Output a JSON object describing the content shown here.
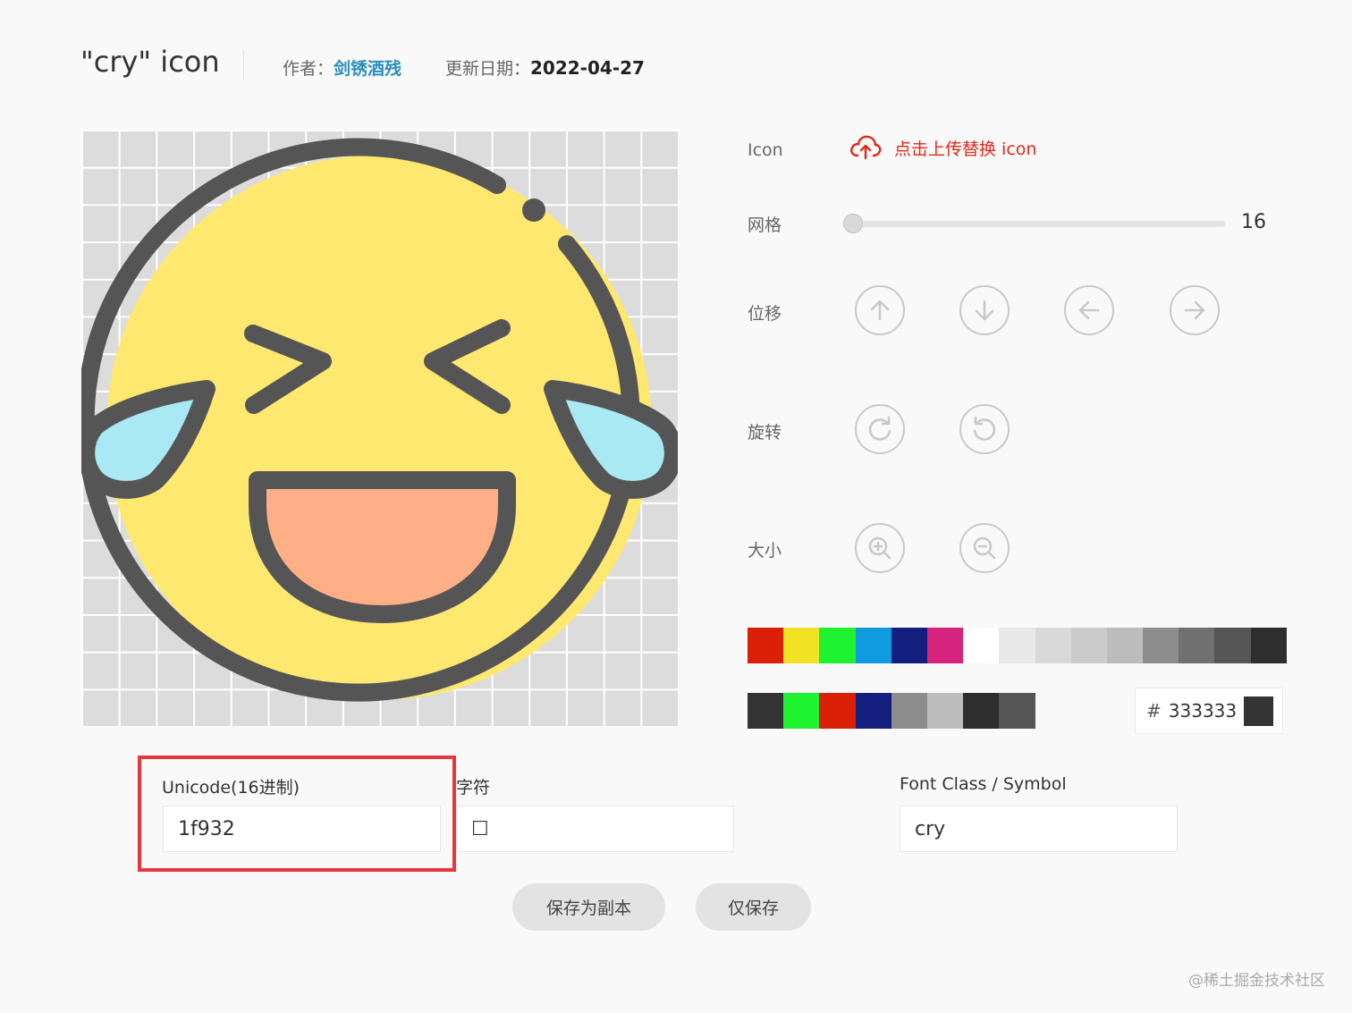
{
  "header": {
    "title": "\"cry\"  icon",
    "author_label": "作者：",
    "author_name": "剑锈酒残",
    "date_label": "更新日期：",
    "date_value": "2022-04-27"
  },
  "controls": {
    "icon_label": "Icon",
    "upload_text": "点击上传替换 icon",
    "grid_label": "网格",
    "grid_value": "16",
    "move_label": "位移",
    "rotate_label": "旋转",
    "size_label": "大小",
    "move_buttons": [
      "arrow-up-icon",
      "arrow-down-icon",
      "arrow-left-icon",
      "arrow-right-icon"
    ],
    "rotate_buttons": [
      "rotate-clockwise-icon",
      "rotate-counterclockwise-icon"
    ],
    "size_buttons": [
      "zoom-in-icon",
      "zoom-out-icon"
    ]
  },
  "palette": {
    "main": [
      "#db1e06",
      "#f1e225",
      "#1ff22e",
      "#119bdf",
      "#131f7f",
      "#d5237e",
      "#ffffff",
      "#e8e8e8",
      "#d9d9d9",
      "#cbcbcb",
      "#bcbcbc",
      "#8d8d8d",
      "#707070",
      "#565656",
      "#2e2e2e"
    ],
    "recent": [
      "#333333",
      "#1ff22e",
      "#db1e06",
      "#131f7f",
      "#8d8d8d",
      "#bcbcbc",
      "#2e2e2e",
      "#565656"
    ],
    "hex_symbol": "#",
    "hex_value": "333333",
    "current_color": "#333333"
  },
  "fields": {
    "unicode_label": "Unicode(16进制)",
    "unicode_value": "1f932",
    "char_label": "字符",
    "char_value": "☐",
    "fontclass_label": "Font Class / Symbol",
    "fontclass_value": "cry"
  },
  "actions": {
    "save_copy": "保存为副本",
    "save_only": "仅保存"
  },
  "watermark": "@稀土掘金技术社区",
  "emoji_colors": {
    "outline": "#555555",
    "face": "#ffe86f",
    "tear": "#a8e9f3",
    "mouth": "#ffaf86"
  }
}
